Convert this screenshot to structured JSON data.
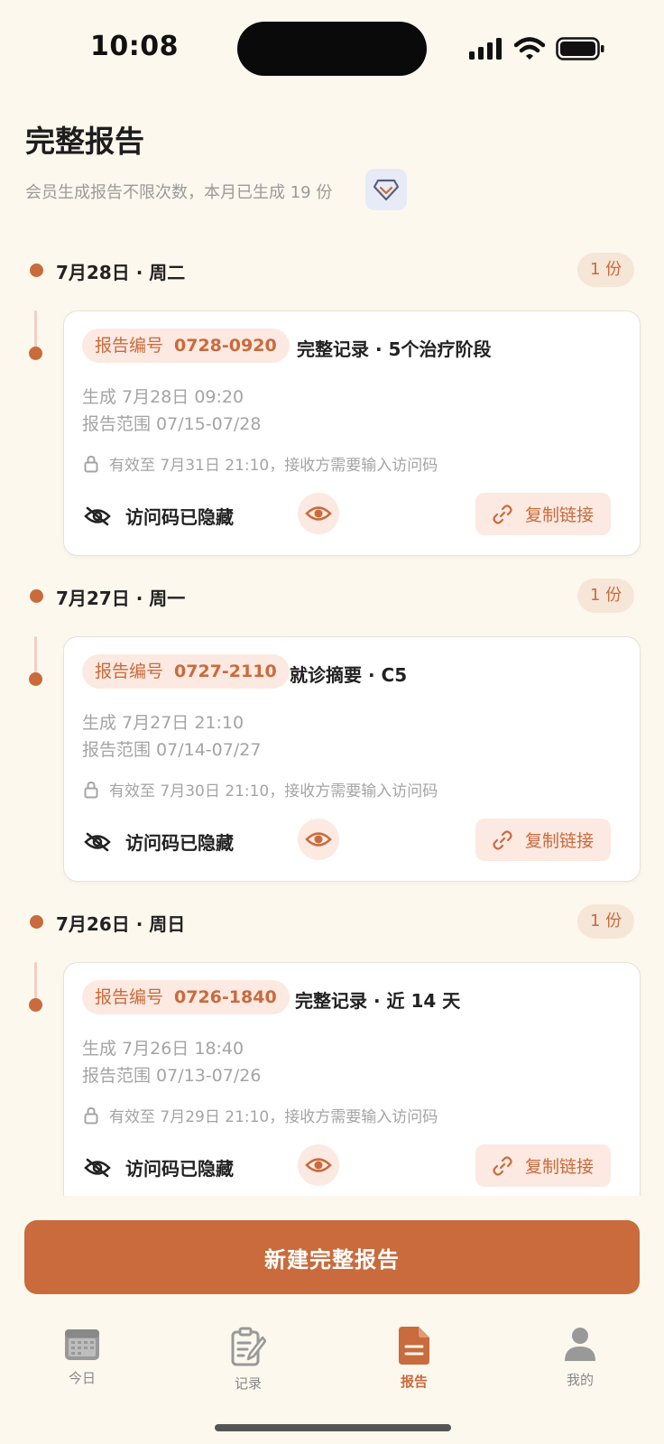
{
  "status_bar": {
    "time": "10:08"
  },
  "header": {
    "title": "完整报告",
    "subtitle": "会员生成报告不限次数，本月已生成 19 份"
  },
  "groups": [
    {
      "date": "7月28日 · 周二",
      "count": "1 份",
      "card": {
        "id_label": "报告编号",
        "id_value": "0728-0920",
        "type": "完整记录 · 5个治疗阶段",
        "generated": "生成 7月28日 09:20",
        "range": "报告范围 07/15-07/28",
        "validity": "有效至 7月31日 21:10，接收方需要输入访问码",
        "hidden_label": "访问码已隐藏",
        "copy_label": "复制链接"
      }
    },
    {
      "date": "7月27日 · 周一",
      "count": "1 份",
      "card": {
        "id_label": "报告编号",
        "id_value": "0727-2110",
        "type": "就诊摘要 · C5",
        "generated": "生成 7月27日 21:10",
        "range": "报告范围 07/14-07/27",
        "validity": "有效至 7月30日 21:10，接收方需要输入访问码",
        "hidden_label": "访问码已隐藏",
        "copy_label": "复制链接"
      }
    },
    {
      "date": "7月26日 · 周日",
      "count": "1 份",
      "card": {
        "id_label": "报告编号",
        "id_value": "0726-1840",
        "type": "完整记录 · 近 14 天",
        "generated": "生成 7月26日 18:40",
        "range": "报告范围 07/13-07/26",
        "validity": "有效至 7月29日 21:10，接收方需要输入访问码",
        "hidden_label": "访问码已隐藏",
        "copy_label": "复制链接"
      }
    }
  ],
  "primary_button": "新建完整报告",
  "tabs": [
    {
      "label": "今日",
      "icon": "calendar-icon"
    },
    {
      "label": "记录",
      "icon": "edit-note-icon"
    },
    {
      "label": "报告",
      "icon": "document-icon",
      "active": true
    },
    {
      "label": "我的",
      "icon": "user-icon"
    }
  ],
  "colors": {
    "accent": "#c96b3c",
    "background": "#fdf8ee",
    "pill_bg": "#fbe9e2"
  }
}
